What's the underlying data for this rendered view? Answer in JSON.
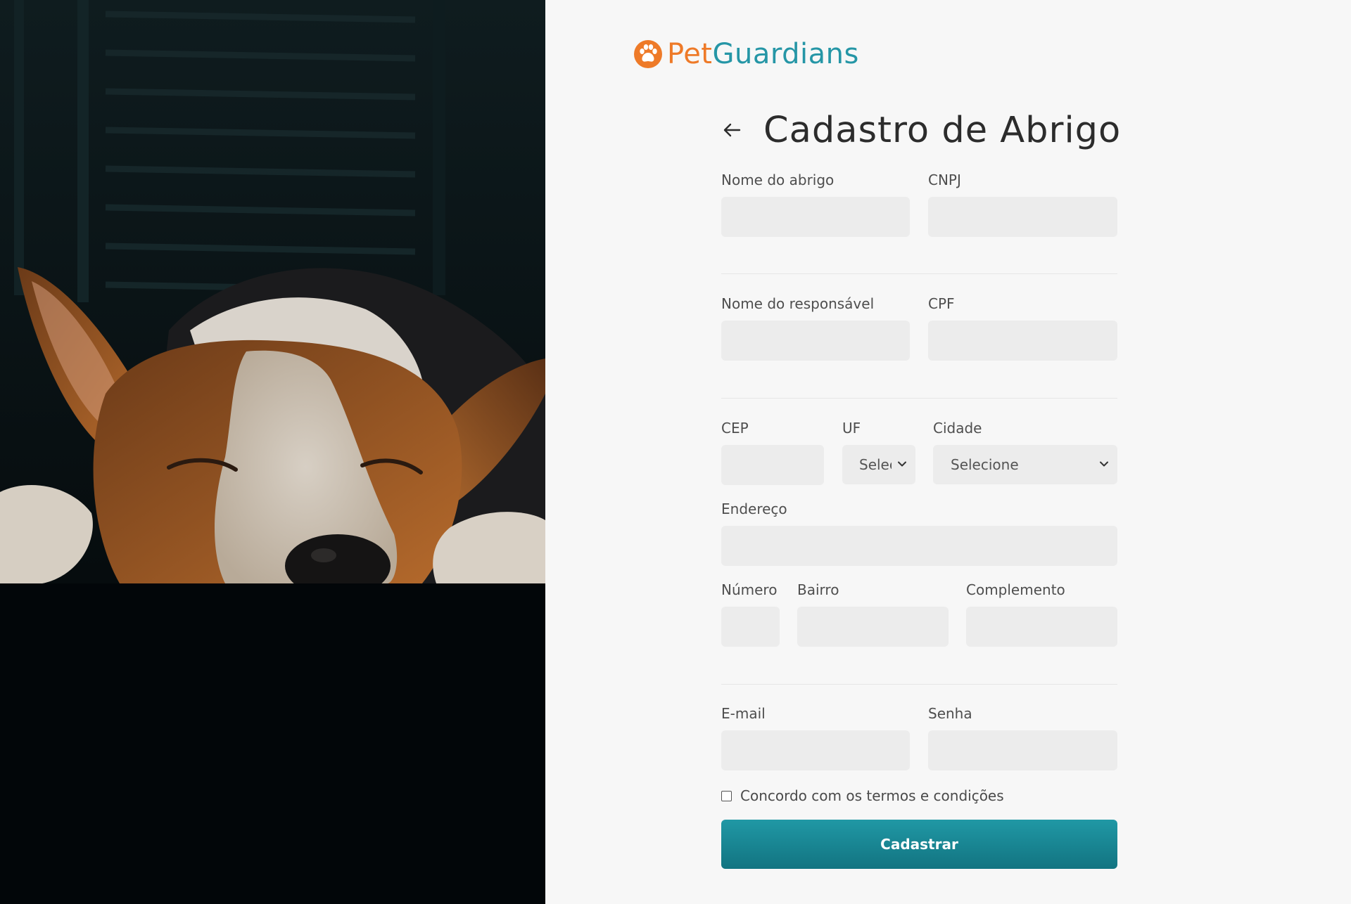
{
  "brand": {
    "name_part1": "Pet",
    "name_part2": "Guardians",
    "color_orange": "#ee7a28",
    "color_teal": "#2596a6"
  },
  "header": {
    "title": "Cadastro de Abrigo"
  },
  "form": {
    "shelter_name": {
      "label": "Nome do abrigo",
      "value": ""
    },
    "cnpj": {
      "label": "CNPJ",
      "value": ""
    },
    "responsible_name": {
      "label": "Nome do responsável",
      "value": ""
    },
    "cpf": {
      "label": "CPF",
      "value": ""
    },
    "cep": {
      "label": "CEP",
      "value": ""
    },
    "uf": {
      "label": "UF",
      "selected": "Selecione"
    },
    "city": {
      "label": "Cidade",
      "selected": "Selecione"
    },
    "address": {
      "label": "Endereço",
      "value": ""
    },
    "number": {
      "label": "Número",
      "value": ""
    },
    "neighborhood": {
      "label": "Bairro",
      "value": ""
    },
    "complement": {
      "label": "Complemento",
      "value": ""
    },
    "email": {
      "label": "E-mail",
      "value": ""
    },
    "password": {
      "label": "Senha",
      "value": ""
    },
    "terms": {
      "label": "Concordo com os termos e condições",
      "checked": false
    },
    "submit_label": "Cadastrar"
  },
  "colors": {
    "button_top": "#2098a5",
    "button_bottom": "#127481",
    "input_bg": "#ececec",
    "page_bg": "#f7f7f7"
  }
}
